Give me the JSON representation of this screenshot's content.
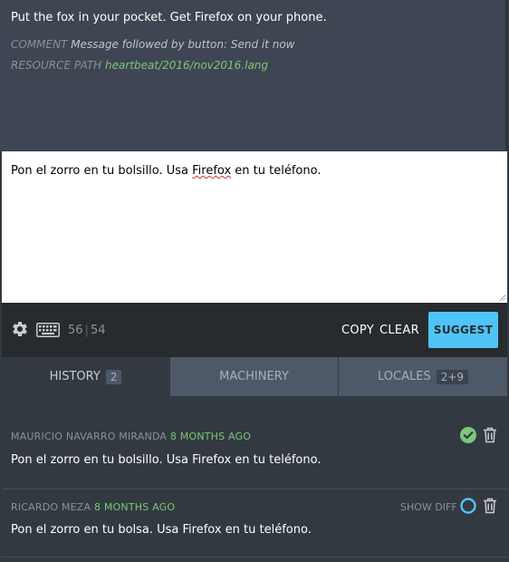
{
  "source": {
    "text": "Put the fox in your pocket. Get Firefox on your phone.",
    "comment_label": "COMMENT",
    "comment_value": "Message followed by button: Send it now",
    "resource_label": "RESOURCE PATH",
    "resource_path": "heartbeat/2016/nov2016.lang"
  },
  "editor": {
    "text_before": "Pon el zorro en tu bolsillo. Usa ",
    "misspelled_word": "Firefox",
    "text_after": " en tu teléfono."
  },
  "toolbar": {
    "settings_icon": "gear-icon",
    "keyboard_icon": "keyboard-icon",
    "translation_length": "56",
    "source_length": "54",
    "copy_label": "COPY",
    "clear_label": "CLEAR",
    "suggest_label": "SUGGEST",
    "suggest_color": "#4fc4f6"
  },
  "tabs": [
    {
      "label": "HISTORY",
      "count": "2",
      "active": true
    },
    {
      "label": "MACHINERY",
      "count": "",
      "active": false
    },
    {
      "label": "LOCALES",
      "count": "2+9",
      "active": false
    }
  ],
  "history": [
    {
      "author": "MAURICIO NAVARRO MIRANDA",
      "when": "8 MONTHS AGO",
      "text": "Pon el zorro en tu bolsillo. Usa Firefox en tu teléfono.",
      "status": "approved",
      "status_color": "#7bc876"
    },
    {
      "author": "RICARDO MEZA",
      "when": "8 MONTHS AGO",
      "show_diff_label": "SHOW DIFF",
      "text": "Pon el zorro en tu bolsa. Usa Firefox en tu teléfono.",
      "status": "unreviewed",
      "status_color": "#4fc4f6"
    }
  ]
}
